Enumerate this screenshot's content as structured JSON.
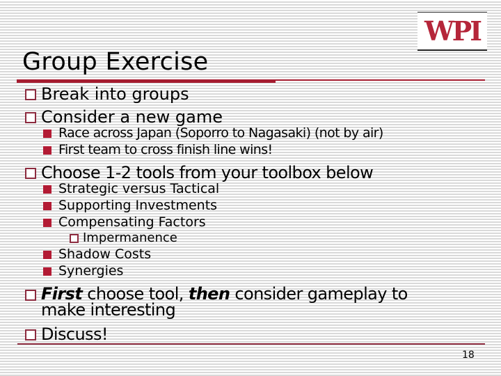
{
  "slide": {
    "logo": "WPI",
    "title": "Group Exercise",
    "bullets": {
      "b1": "Break into groups",
      "b2": "Consider a new game",
      "b2_sub1": "Race across Japan (Soporro to Nagasaki)  (not by air)",
      "b2_sub2": "First team to cross finish line wins!",
      "b3": "Choose 1-2 tools from your toolbox below",
      "b3_sub1": "Strategic versus Tactical",
      "b3_sub2": "Supporting Investments",
      "b3_sub3": "Compensating Factors",
      "b3_sub3_sub1": "Impermanence",
      "b3_sub4": "Shadow Costs",
      "b3_sub5": "Synergies",
      "b4_em1": "First",
      "b4_mid": " choose tool, ",
      "b4_em2": "then",
      "b4_end": " consider gameplay to",
      "b4_line2": "make interesting",
      "b5": "Discuss!"
    },
    "page_number": "18",
    "colors": {
      "accent": "#a51c30",
      "bullet_square": "#b31b34",
      "bullet_box": "#8c2a3e"
    }
  }
}
